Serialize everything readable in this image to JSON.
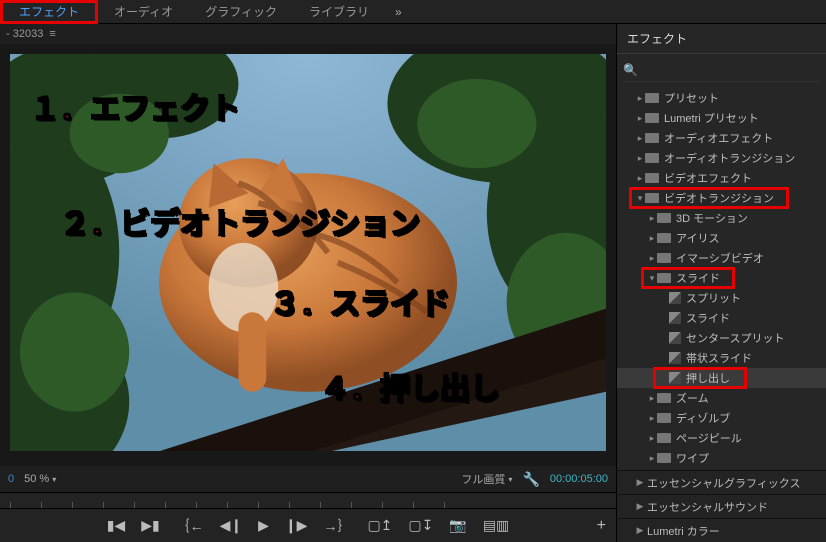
{
  "tabs": {
    "items": [
      "エフェクト",
      "オーディオ",
      "グラフィック",
      "ライブラリ"
    ],
    "selected": 0,
    "more": "»"
  },
  "breadcrumb": {
    "project": "- 32033",
    "menu_glyph": "≡"
  },
  "preview": {
    "zoom": "50 %",
    "fit_label": "フル画質",
    "timecode": "00:00:05:00"
  },
  "overlay": {
    "l1": "１．エフェクト",
    "l2": "２．ビデオトランジション",
    "l3": "３．スライド",
    "l4": "４．押し出し"
  },
  "effects_panel": {
    "title": "エフェクト",
    "search_placeholder": "",
    "tree": [
      {
        "label": "プリセット",
        "kind": "folder",
        "level": 1,
        "caret": "right"
      },
      {
        "label": "Lumetri プリセット",
        "kind": "folder",
        "level": 1,
        "caret": "right"
      },
      {
        "label": "オーディオエフェクト",
        "kind": "folder",
        "level": 1,
        "caret": "right"
      },
      {
        "label": "オーディオトランジション",
        "kind": "folder",
        "level": 1,
        "caret": "right"
      },
      {
        "label": "ビデオエフェクト",
        "kind": "folder",
        "level": 1,
        "caret": "right"
      },
      {
        "label": "ビデオトランジション",
        "kind": "folder",
        "level": 1,
        "caret": "down",
        "highlight": true
      },
      {
        "label": "3D モーション",
        "kind": "folder",
        "level": 2,
        "caret": "right"
      },
      {
        "label": "アイリス",
        "kind": "folder",
        "level": 2,
        "caret": "right"
      },
      {
        "label": "イマーシブビデオ",
        "kind": "folder",
        "level": 2,
        "caret": "right"
      },
      {
        "label": "スライド",
        "kind": "folder",
        "level": 2,
        "caret": "down",
        "highlight": true
      },
      {
        "label": "スプリット",
        "kind": "effect",
        "level": 3
      },
      {
        "label": "スライド",
        "kind": "effect",
        "level": 3
      },
      {
        "label": "センタースプリット",
        "kind": "effect",
        "level": 3
      },
      {
        "label": "帯状スライド",
        "kind": "effect",
        "level": 3
      },
      {
        "label": "押し出し",
        "kind": "effect",
        "level": 3,
        "selected": true,
        "highlight": true
      },
      {
        "label": "ズーム",
        "kind": "folder",
        "level": 2,
        "caret": "right"
      },
      {
        "label": "ディゾルブ",
        "kind": "folder",
        "level": 2,
        "caret": "right"
      },
      {
        "label": "ページピール",
        "kind": "folder",
        "level": 2,
        "caret": "right"
      },
      {
        "label": "ワイプ",
        "kind": "folder",
        "level": 2,
        "caret": "right"
      }
    ]
  },
  "bottom_panels": {
    "items": [
      "エッセンシャルグラフィックス",
      "エッセンシャルサウンド",
      "Lumetri カラー"
    ]
  },
  "transport": {
    "add": "+"
  }
}
